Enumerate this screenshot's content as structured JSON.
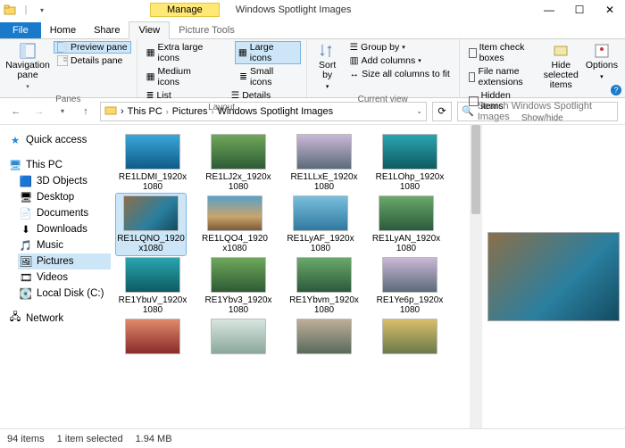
{
  "window": {
    "title": "Windows Spotlight Images",
    "manage_tab": "Manage"
  },
  "tabs": {
    "file": "File",
    "home": "Home",
    "share": "Share",
    "view": "View",
    "picture": "Picture Tools"
  },
  "ribbon": {
    "panes": {
      "nav": "Navigation\npane",
      "preview": "Preview pane",
      "details": "Details pane",
      "group": "Panes"
    },
    "layout": {
      "xl": "Extra large icons",
      "lg": "Large icons",
      "md": "Medium icons",
      "sm": "Small icons",
      "list": "List",
      "det": "Details",
      "group": "Layout"
    },
    "current": {
      "sort": "Sort\nby",
      "groupby": "Group by",
      "addcol": "Add columns",
      "sizeall": "Size all columns to fit",
      "group": "Current view"
    },
    "showhide": {
      "chk": "Item check boxes",
      "ext": "File name extensions",
      "hid": "Hidden items",
      "hidesel": "Hide selected\nitems",
      "opts": "Options",
      "group": "Show/hide"
    }
  },
  "breadcrumbs": {
    "root": "This PC",
    "lvl1": "Pictures",
    "lvl2": "Windows Spotlight Images"
  },
  "search": {
    "placeholder": "Search Windows Spotlight Images"
  },
  "sidebar": {
    "quick": "Quick access",
    "thispc": "This PC",
    "items": [
      "3D Objects",
      "Desktop",
      "Documents",
      "Downloads",
      "Music",
      "Pictures",
      "Videos",
      "Local Disk (C:)"
    ],
    "network": "Network"
  },
  "files": {
    "row1": [
      "RE1LDMI_1920x1080",
      "RE1LJ2x_1920x1080",
      "RE1LLxE_1920x1080",
      "RE1LOhp_1920x1080"
    ],
    "row2": [
      "RE1LQNO_1920x1080",
      "RE1LQO4_1920x1080",
      "RE1LyAF_1920x1080",
      "RE1LyAN_1920x1080"
    ],
    "row3": [
      "RE1YbuV_1920x1080",
      "RE1Ybv3_1920x1080",
      "RE1Ybvm_1920x1080",
      "RE1Ye6p_1920x1080"
    ]
  },
  "status": {
    "count": "94 items",
    "sel": "1 item selected",
    "size": "1.94 MB"
  }
}
